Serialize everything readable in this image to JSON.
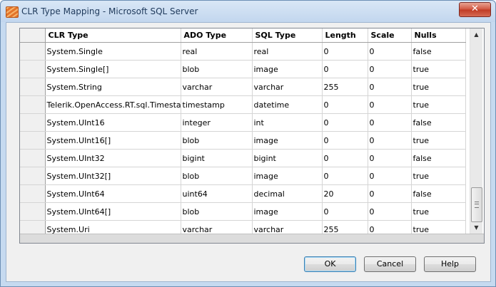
{
  "window": {
    "title": "CLR Type Mapping - Microsoft SQL Server",
    "close_label": "✕"
  },
  "grid": {
    "columns": [
      "CLR Type",
      "ADO Type",
      "SQL Type",
      "Length",
      "Scale",
      "Nulls"
    ],
    "rows": [
      [
        "System.Single",
        "real",
        "real",
        "0",
        "0",
        "false"
      ],
      [
        "System.Single[]",
        "blob",
        "image",
        "0",
        "0",
        "true"
      ],
      [
        "System.String",
        "varchar",
        "varchar",
        "255",
        "0",
        "true"
      ],
      [
        "Telerik.OpenAccess.RT.sql.Timesta",
        "timestamp",
        "datetime",
        "0",
        "0",
        "true"
      ],
      [
        "System.UInt16",
        "integer",
        "int",
        "0",
        "0",
        "false"
      ],
      [
        "System.UInt16[]",
        "blob",
        "image",
        "0",
        "0",
        "true"
      ],
      [
        "System.UInt32",
        "bigint",
        "bigint",
        "0",
        "0",
        "false"
      ],
      [
        "System.UInt32[]",
        "blob",
        "image",
        "0",
        "0",
        "true"
      ],
      [
        "System.UInt64",
        "uint64",
        "decimal",
        "20",
        "0",
        "false"
      ],
      [
        "System.UInt64[]",
        "blob",
        "image",
        "0",
        "0",
        "true"
      ],
      [
        "System.Uri",
        "varchar",
        "varchar",
        "255",
        "0",
        "true"
      ]
    ]
  },
  "scrollbar": {
    "up_glyph": "▲",
    "down_glyph": "▼"
  },
  "buttons": {
    "ok": "OK",
    "cancel": "Cancel",
    "help": "Help"
  }
}
